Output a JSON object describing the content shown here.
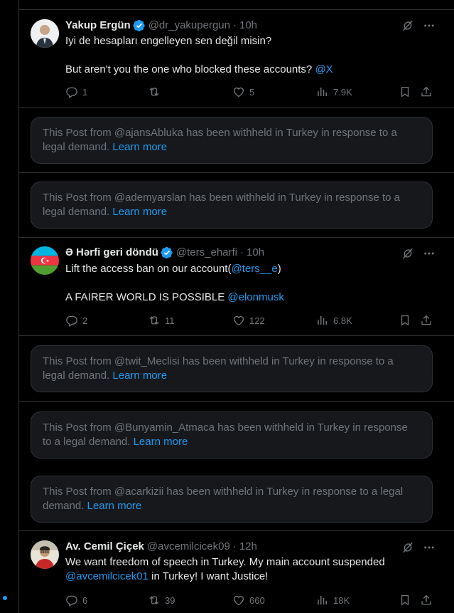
{
  "posts": [
    {
      "name": "Yakup Ergün",
      "handle": "@dr_yakupergun",
      "time": "10h",
      "line1": "Iyi de hesapları engelleyen sen değil misin?",
      "line2": "But aren't you the one who blocked these accounts?",
      "line2_link": "@X",
      "replies": "1",
      "reposts": "",
      "likes": "5",
      "views": "7.9K"
    },
    {
      "name": "Ə Hərfi geri döndü",
      "handle": "@ters_eharfi",
      "time": "10h",
      "line1": "Lift the access ban on our account(",
      "line1_link": "@ters__e",
      "line1_end": ")",
      "line2": "A FAIRER WORLD IS POSSIBLE",
      "line2_link": "@elonmusk",
      "replies": "2",
      "reposts": "11",
      "likes": "122",
      "views": "6.8K"
    },
    {
      "name": "Av. Cemil Çiçek",
      "handle": "@avcemilcicek09",
      "time": "12h",
      "line1": "We want freedom of speech in Turkey. My main account suspended",
      "line2_link": "@avcemilcicek01",
      "line2": " in Turkey! I want Justice!",
      "replies": "6",
      "reposts": "39",
      "likes": "660",
      "views": "18K"
    }
  ],
  "withheld": [
    {
      "a": "This Post from @ajansAbluka has been withheld in Turkey in response to a",
      "b": "legal demand.",
      "link": "Learn more"
    },
    {
      "a": "This Post from @ademyarslan has been withheld in Turkey in response to a",
      "b": "legal demand.",
      "link": "Learn more"
    },
    {
      "a": "This Post from @twit_Meclisi has been withheld in Turkey in response to a",
      "b": "legal demand.",
      "link": "Learn more"
    },
    {
      "a": "This Post from @Bunyamin_Atmaca has been withheld in Turkey in response",
      "b": "to a legal demand.",
      "link": "Learn more"
    },
    {
      "a": "This Post from @acarkizii has been withheld in Turkey in response to a legal",
      "b": "demand.",
      "link": "Learn more"
    }
  ],
  "icons": {
    "verified": "verified-badge-icon",
    "grok": "grok-icon",
    "more": "more-icon",
    "reply": "reply-icon",
    "repost": "repost-icon",
    "like": "like-icon",
    "views": "views-icon",
    "bookmark": "bookmark-icon",
    "share": "share-icon"
  },
  "colors": {
    "background": "#000000",
    "link": "#1d9bf0",
    "muted": "#71767b",
    "card": "#16181c"
  }
}
